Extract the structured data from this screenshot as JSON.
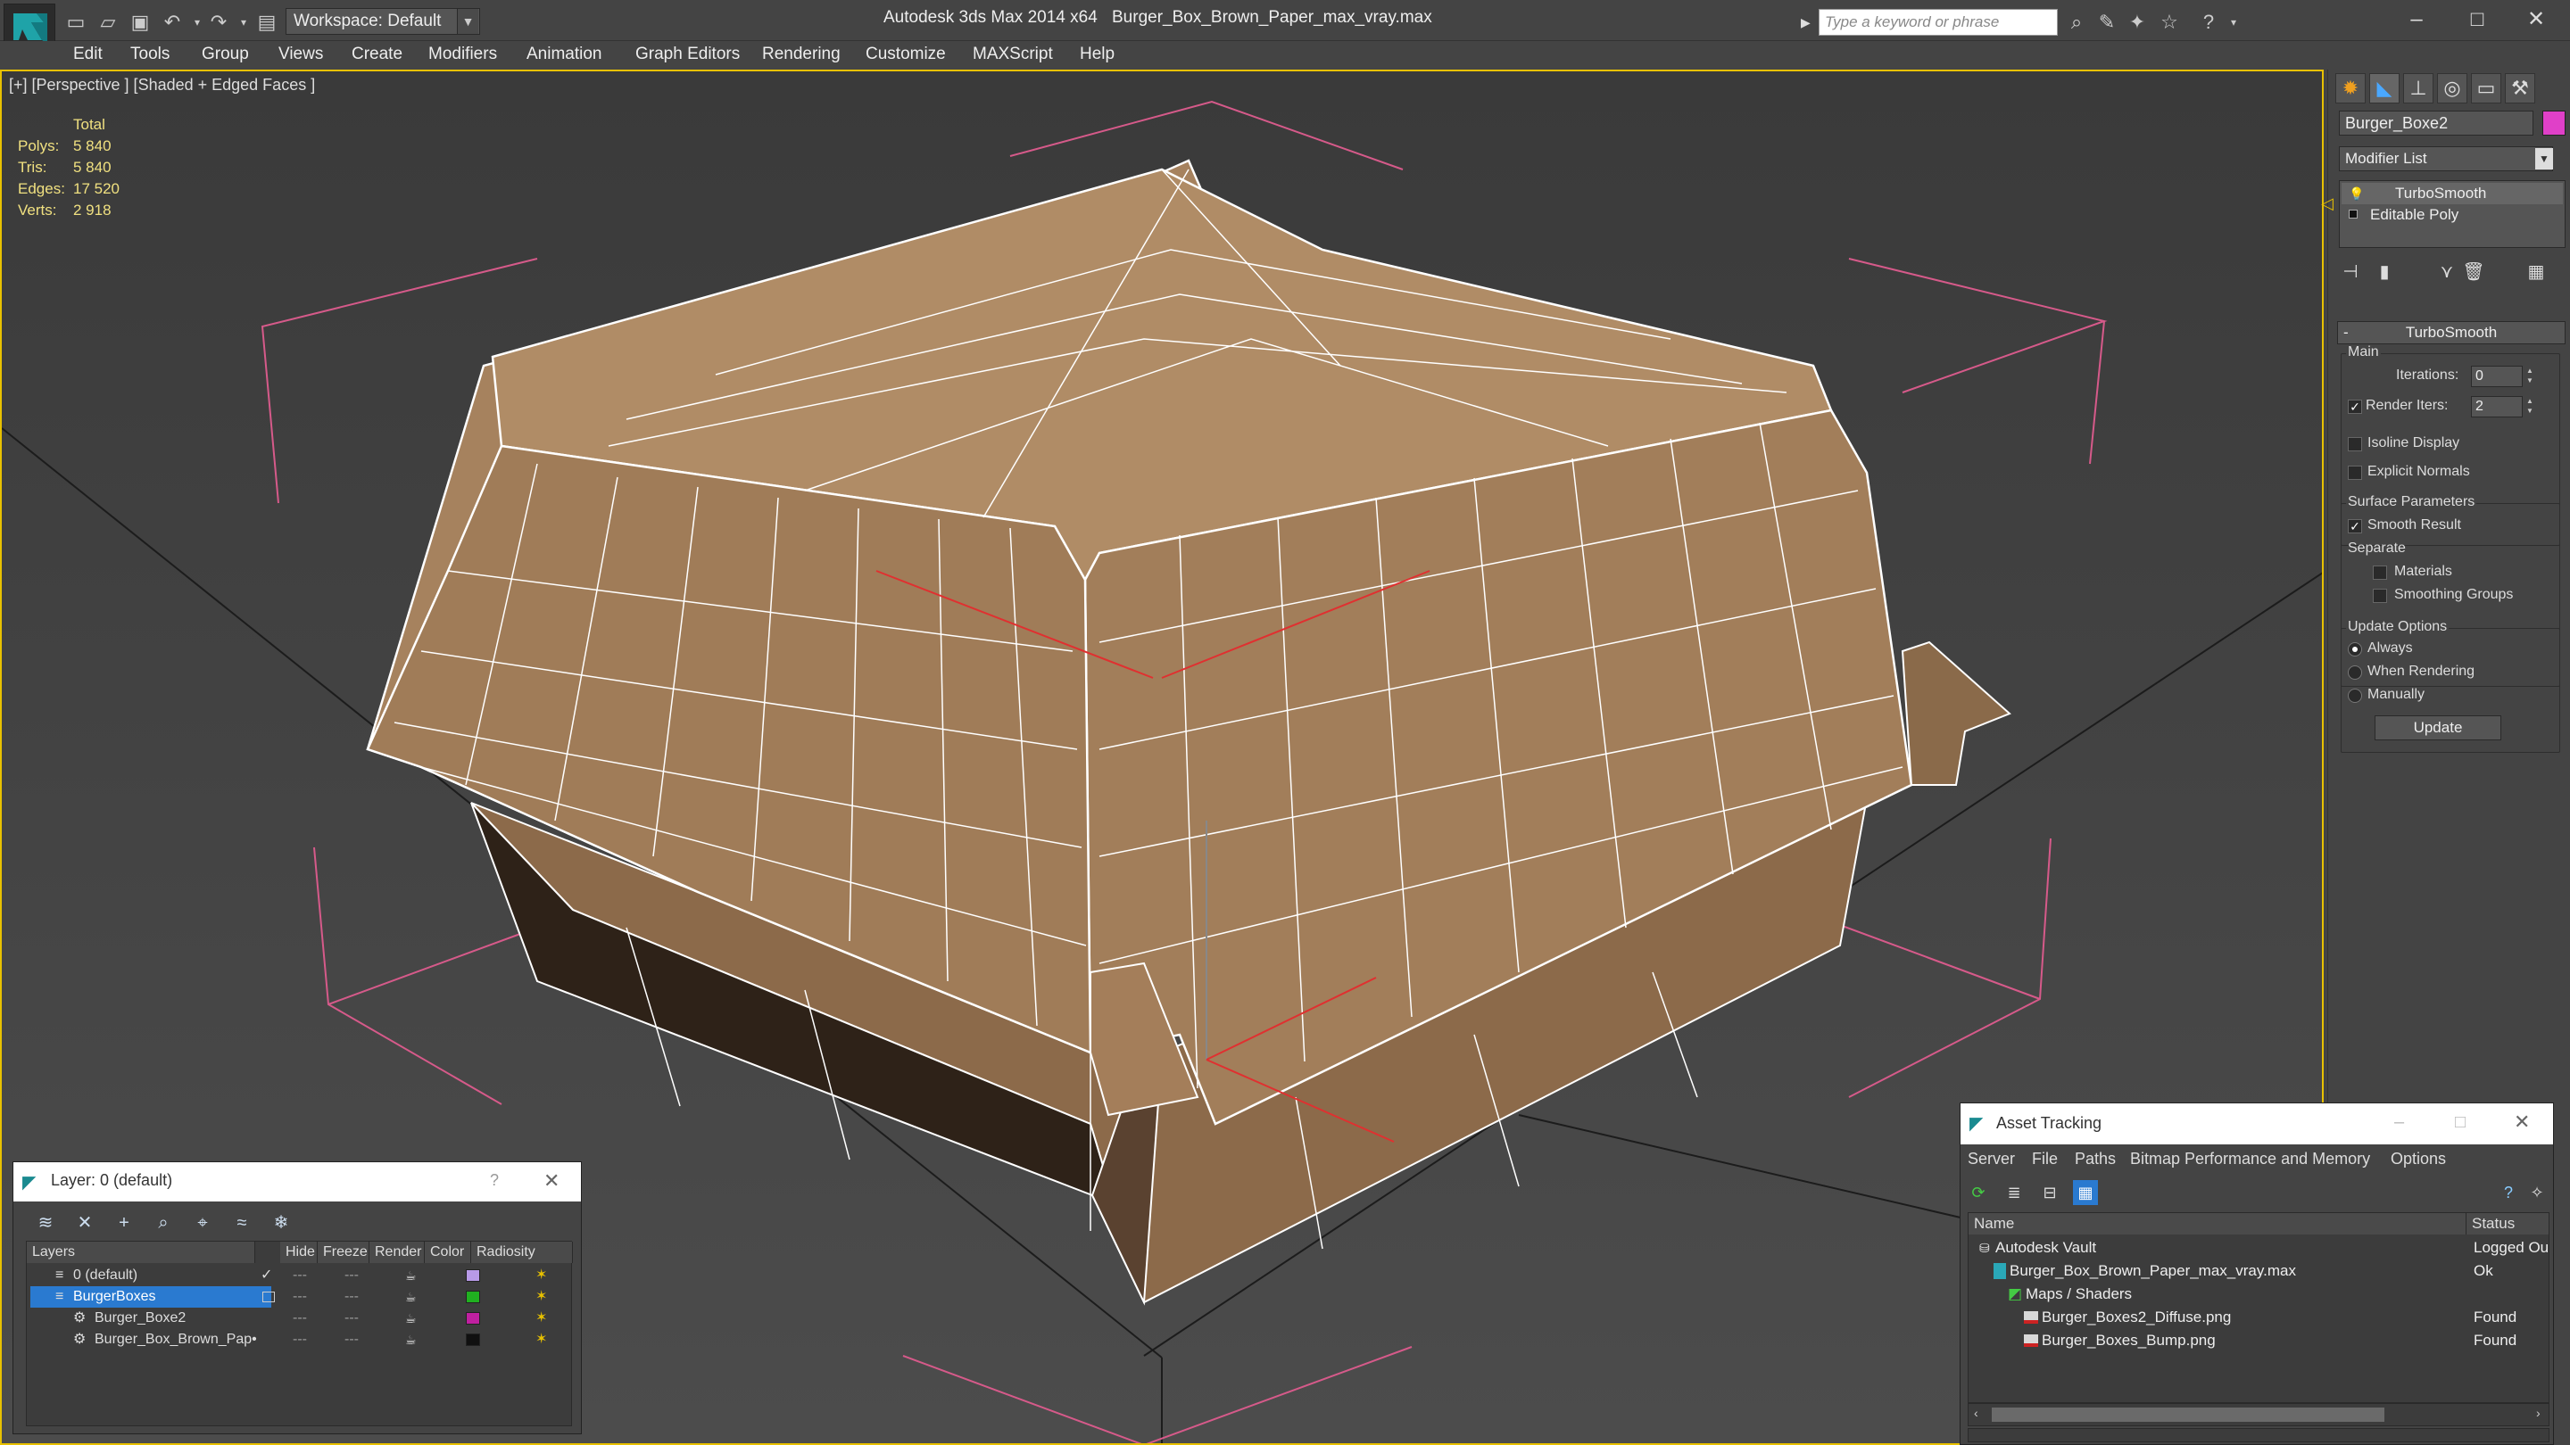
{
  "titlebar": {
    "workspace": "Workspace: Default",
    "app_title": "Autodesk 3ds Max  2014 x64",
    "file_title": "Burger_Box_Brown_Paper_max_vray.max",
    "search_placeholder": "Type a keyword or phrase"
  },
  "menu": [
    "Edit",
    "Tools",
    "Group",
    "Views",
    "Create",
    "Modifiers",
    "Animation",
    "Graph Editors",
    "Rendering",
    "Customize",
    "MAXScript",
    "Help"
  ],
  "viewport": {
    "label": "[+] [Perspective ] [Shaded + Edged Faces ]",
    "stats": {
      "header": "Total",
      "rows": [
        {
          "label": "Polys:",
          "value": "5 840"
        },
        {
          "label": "Tris:",
          "value": "5 840"
        },
        {
          "label": "Edges:",
          "value": "17 520"
        },
        {
          "label": "Verts:",
          "value": "2 918"
        }
      ]
    }
  },
  "command_panel": {
    "object_name": "Burger_Boxe2",
    "object_color": "#e040c8",
    "modifier_list": "Modifier List",
    "stack": [
      "TurboSmooth",
      "Editable Poly"
    ],
    "rollout": "TurboSmooth",
    "main_group": "Main",
    "iterations_label": "Iterations:",
    "iterations_value": "0",
    "render_iters_label": "Render Iters:",
    "render_iters_value": "2",
    "isoline": "Isoline Display",
    "explicit_normals": "Explicit Normals",
    "surface_group": "Surface Parameters",
    "smooth_result": "Smooth Result",
    "separate": "Separate",
    "materials": "Materials",
    "smoothing_groups": "Smoothing Groups",
    "update_group": "Update Options",
    "always": "Always",
    "when_rendering": "When Rendering",
    "manually": "Manually",
    "update_button": "Update"
  },
  "layer_dialog": {
    "title": "Layer: 0 (default)",
    "help": "?",
    "columns": [
      "Layers",
      "Hide",
      "Freeze",
      "Render",
      "Color",
      "Radiosity"
    ],
    "rows": [
      {
        "name": "0 (default)",
        "color": "#b89ae8"
      },
      {
        "name": "BurgerBoxes",
        "color": "#20b020"
      },
      {
        "name": "Burger_Boxe2",
        "color": "#c020a0"
      },
      {
        "name": "Burger_Box_Brown_Pap•",
        "color": "#101010"
      }
    ]
  },
  "asset_dialog": {
    "title": "Asset Tracking",
    "menu": [
      "Server",
      "File",
      "Paths",
      "Bitmap Performance and Memory",
      "Options"
    ],
    "columns": [
      "Name",
      "Status"
    ],
    "rows": [
      {
        "name": "Autodesk Vault",
        "status": "Logged Ou"
      },
      {
        "name": "Burger_Box_Brown_Paper_max_vray.max",
        "status": "Ok"
      },
      {
        "name": "Maps / Shaders",
        "status": ""
      },
      {
        "name": "Burger_Boxes2_Diffuse.png",
        "status": "Found"
      },
      {
        "name": "Burger_Boxes_Bump.png",
        "status": "Found"
      }
    ]
  }
}
